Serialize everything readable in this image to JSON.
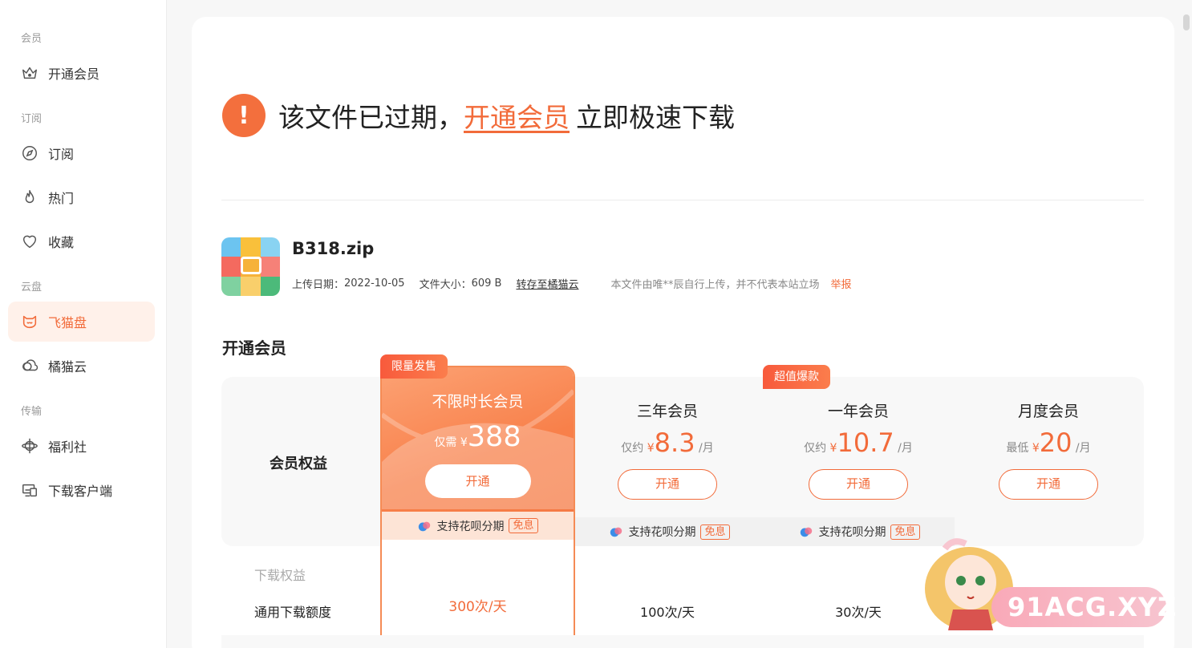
{
  "sidebar": {
    "groups": [
      {
        "label": "会员",
        "items": [
          {
            "label": "开通会员",
            "icon": "crown-icon"
          }
        ]
      },
      {
        "label": "订阅",
        "items": [
          {
            "label": "订阅",
            "icon": "compass-icon"
          },
          {
            "label": "热门",
            "icon": "flame-icon"
          },
          {
            "label": "收藏",
            "icon": "heart-icon"
          }
        ]
      },
      {
        "label": "云盘",
        "items": [
          {
            "label": "飞猫盘",
            "icon": "cat-icon",
            "active": true
          },
          {
            "label": "橘猫云",
            "icon": "cloud-icon"
          }
        ]
      },
      {
        "label": "传输",
        "items": [
          {
            "label": "福利社",
            "icon": "planet-icon"
          },
          {
            "label": "下载客户端",
            "icon": "devices-icon"
          }
        ]
      }
    ]
  },
  "headline": {
    "prefix": "该文件已过期，",
    "link": "开通会员",
    "suffix": "立即极速下载",
    "icon_text": "!"
  },
  "file": {
    "name": "B318.zip",
    "upload_label": "上传日期：",
    "upload_date": "2022-10-05",
    "size_label": "文件大小：",
    "size": "609 B",
    "transfer_link": "转存至橘猫云",
    "notice": "本文件由唯**辰自行上传，并不代表本站立场",
    "report": "举报"
  },
  "section_title": "开通会员",
  "pricing": {
    "benefit_label": "会员权益",
    "huabei_text": "支持花呗分期",
    "free_tag": "免息",
    "plans": [
      {
        "name": "不限时长会员",
        "price_prefix": "仅需",
        "currency": "¥",
        "price": "388",
        "unit": "",
        "button": "开通",
        "badge": "限量发售",
        "featured": true
      },
      {
        "name": "三年会员",
        "price_prefix": "仅约",
        "currency": "¥",
        "price": "8.3",
        "unit": "/月",
        "button": "开通"
      },
      {
        "name": "一年会员",
        "price_prefix": "仅约",
        "currency": "¥",
        "price": "10.7",
        "unit": "/月",
        "button": "开通",
        "badge": "超值爆款"
      },
      {
        "name": "月度会员",
        "price_prefix": "最低",
        "currency": "¥",
        "price": "20",
        "unit": "/月",
        "button": "开通"
      }
    ],
    "rights_label": "下载权益",
    "quota_label": "通用下载额度",
    "quota_values": [
      "300次/天",
      "100次/天",
      "30次/天"
    ]
  },
  "watermark": "91ACG.XYZ",
  "colors": {
    "accent": "#f26b3a",
    "active_bg": "#fff1ea"
  }
}
